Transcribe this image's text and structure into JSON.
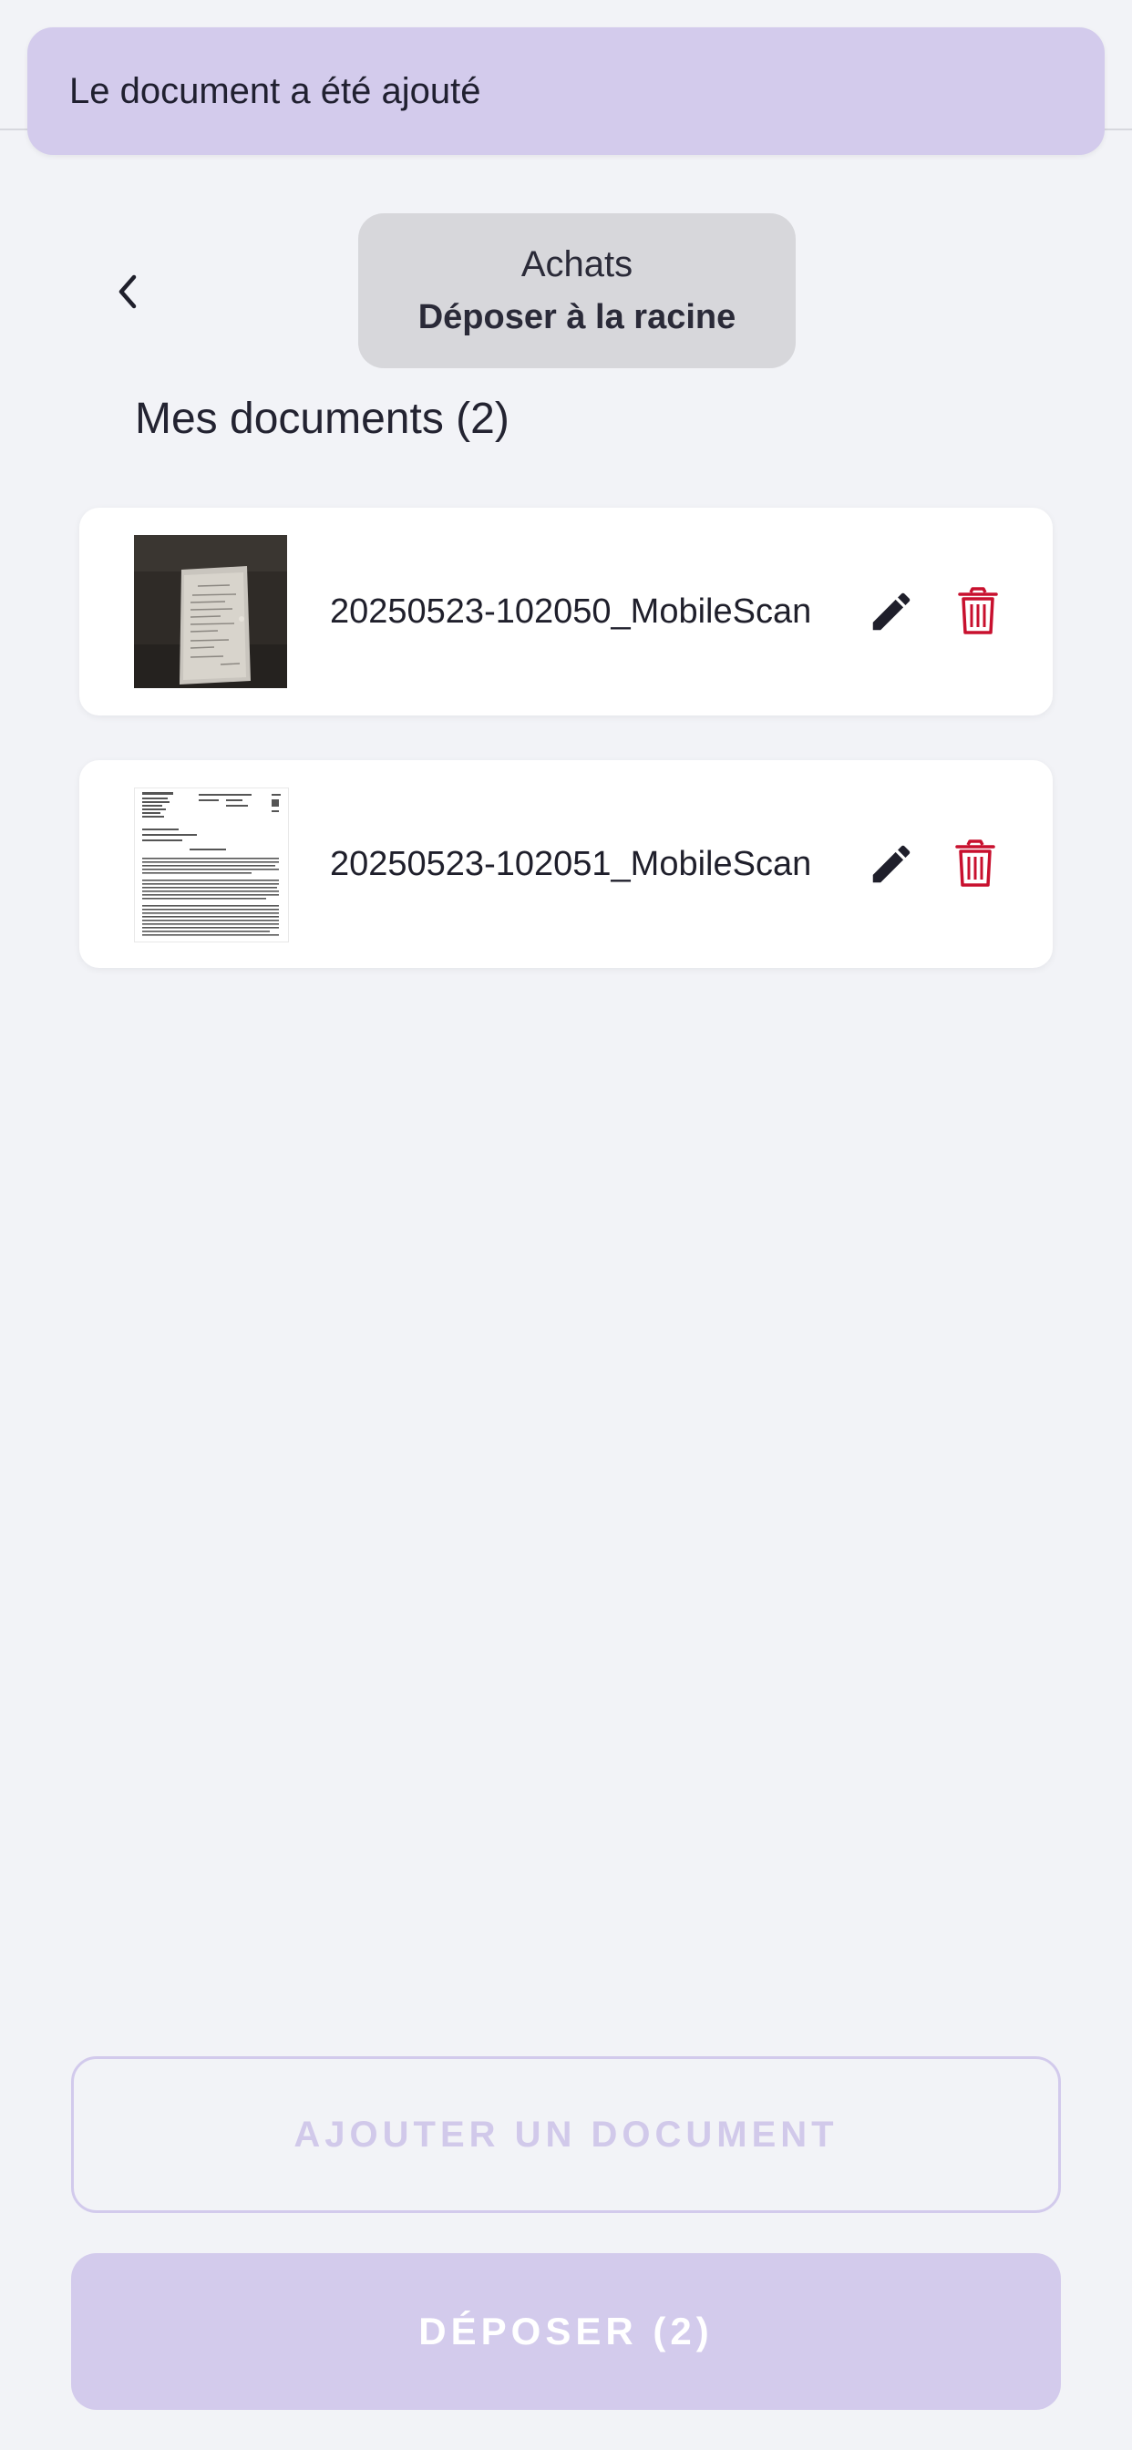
{
  "toast": {
    "message": "Le document a été ajouté"
  },
  "header": {
    "back_icon": "chevron-left-icon"
  },
  "destination": {
    "title": "Achats",
    "subtitle": "Déposer à la racine",
    "background": "#d7d7db"
  },
  "documents": {
    "section_title": "Mes documents (2)",
    "items": [
      {
        "name": "20250523-102050_MobileScan",
        "thumbnail": "receipt-photo",
        "edit_icon": "pencil-icon",
        "delete_icon": "trash-icon"
      },
      {
        "name": "20250523-102051_MobileScan",
        "thumbnail": "document-scan",
        "edit_icon": "pencil-icon",
        "delete_icon": "trash-icon"
      }
    ]
  },
  "actions": {
    "add_label": "AJOUTER UN DOCUMENT",
    "submit_label": "DÉPOSER (2)"
  },
  "colors": {
    "accent": "#d3cbec",
    "delete": "#c8102e",
    "background": "#f2f3f7"
  }
}
